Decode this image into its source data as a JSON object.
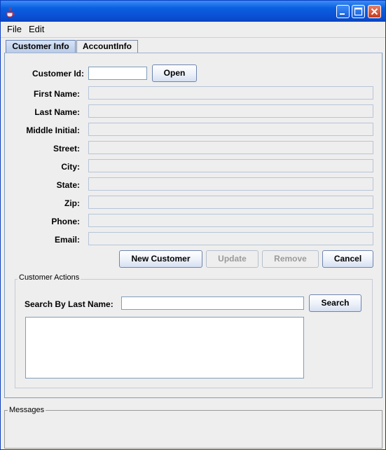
{
  "menu": {
    "file": "File",
    "edit": "Edit"
  },
  "tabs": {
    "customer_info": "Customer Info",
    "account_info": "AccountInfo"
  },
  "form": {
    "customer_id_label": "Customer Id:",
    "open_button": "Open",
    "first_name_label": "First Name:",
    "last_name_label": "Last Name:",
    "middle_initial_label": "Middle Initial:",
    "street_label": "Street:",
    "city_label": "City:",
    "state_label": "State:",
    "zip_label": "Zip:",
    "phone_label": "Phone:",
    "email_label": "Email:"
  },
  "buttons": {
    "new_customer": "New Customer",
    "update": "Update",
    "remove": "Remove",
    "cancel": "Cancel"
  },
  "actions": {
    "title": "Customer Actions",
    "search_label": "Search By Last Name:",
    "search_button": "Search"
  },
  "messages": {
    "title": "Messages"
  },
  "colors": {
    "titlebar": "#0b52d6",
    "tab_selected": "#c6d6ef",
    "panel": "#eeeeee"
  }
}
